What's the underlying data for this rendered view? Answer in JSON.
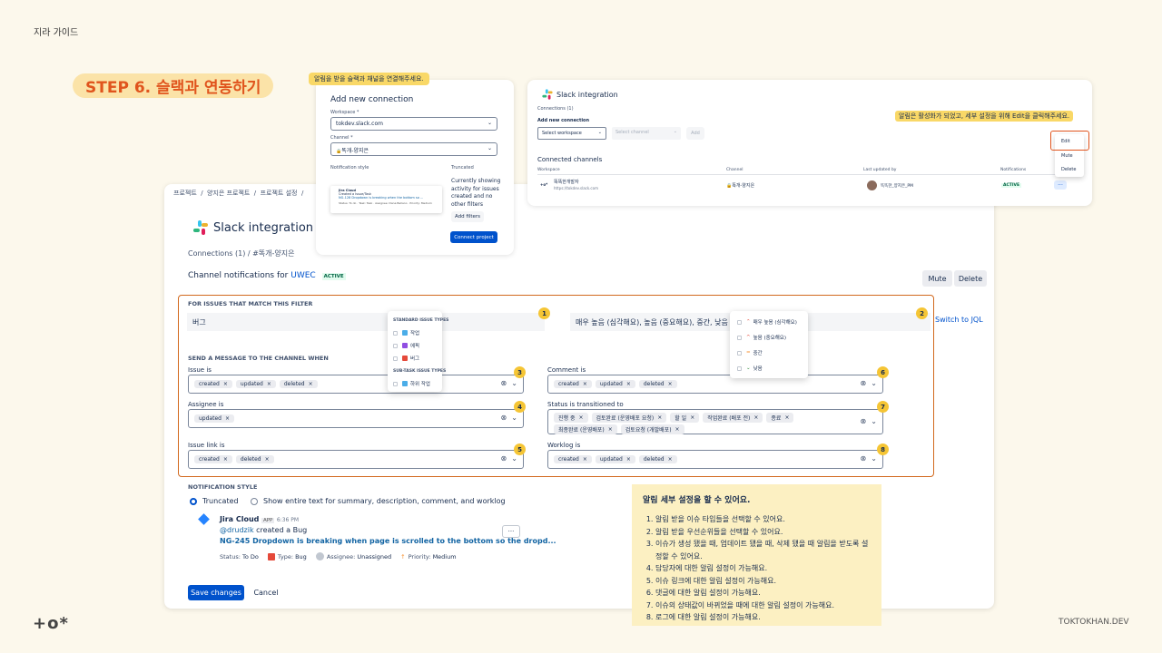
{
  "guide_title": "지라 가이드",
  "step_title": "STEP 6. 슬랙과 연동하기",
  "footer_brand": "TOKTOKHAN.DEV",
  "main": {
    "breadcrumb": [
      "프로젝트",
      "/",
      "양지은 프로젝트",
      "/",
      "프로젝트 설정",
      "/"
    ],
    "title": "Slack integration",
    "connections_crumb": "Connections (1)  /  #똑개-양지은",
    "channel_notif_prefix": "Channel notifications for",
    "channel_notif_name": "UWEC",
    "active_badge": "ACTIVE",
    "mute_label": "Mute",
    "delete_label": "Delete",
    "filter_heading": "FOR ISSUES THAT MATCH THIS FILTER",
    "filter_type_value": "버그",
    "filter_priority_value": "매우 높음 (심각해요), 높음 (중요해요), 중간, 낮음",
    "switch_jql": "Switch to JQL",
    "send_heading": "SEND A MESSAGE TO THE CHANNEL WHEN",
    "issue_is_label": "Issue is",
    "issue_is_chips": [
      "created",
      "updated",
      "deleted"
    ],
    "assignee_label": "Assignee is",
    "assignee_chips": [
      "updated"
    ],
    "issue_link_label": "Issue link is",
    "issue_link_chips": [
      "created",
      "deleted"
    ],
    "comment_label": "Comment is",
    "comment_chips": [
      "created",
      "updated",
      "deleted"
    ],
    "status_label": "Status is transitioned to",
    "status_chips": [
      "진행 중",
      "검토완료 (운영배포 요청)",
      "할 일",
      "작업완료 (배포 전)",
      "종료",
      "최종완료 (운영배포)",
      "검토요청 (개발배포)"
    ],
    "worklog_label": "Worklog is",
    "worklog_chips": [
      "created",
      "updated",
      "deleted"
    ],
    "type_dropdown": {
      "std_header": "STANDARD ISSUE TYPES",
      "items": [
        "작업",
        "에픽",
        "버그"
      ],
      "sub_header": "SUB-TASK ISSUE TYPES",
      "sub_items": [
        "하위 작업"
      ]
    },
    "priority_dropdown": [
      "매우 높음 (심각해요)",
      "높음 (중요해요)",
      "중간",
      "낮음"
    ],
    "notif_style_heading": "NOTIFICATION STYLE",
    "opt_truncated": "Truncated",
    "opt_full": "Show entire text for summary, description, comment, and worklog",
    "preview": {
      "app": "Jira Cloud",
      "app_badge": "APP",
      "time": "6:36 PM",
      "line1_user": "@drudzik",
      "line1_rest": " created a Bug",
      "link": "NG-245 Dropdown is breaking when page is scrolled to the bottom so the dropd...",
      "status_k": "Status:",
      "status_v": "To Do",
      "type_k": "Type:",
      "type_v": "Bug",
      "assignee_k": "Assignee:",
      "assignee_v": "Unassigned",
      "priority_k": "Priority:",
      "priority_v": "Medium",
      "more": "···"
    },
    "save_label": "Save changes",
    "cancel_label": "Cancel"
  },
  "add_conn": {
    "tag": "알림을 받을 슬랙과 채널을 연결해주세요.",
    "title": "Add new connection",
    "ws_label": "Workspace *",
    "ws_value": "tokdev.slack.com",
    "ch_label": "Channel *",
    "ch_value": "똑개-양지은",
    "style_label": "Notification style",
    "trunc_label": "Truncated",
    "trunc_text": "Currently showing activity for issues created and no other filters",
    "add_filters": "Add filters",
    "connect": "Connect project",
    "mini_app": "Jira Cloud",
    "mini_text1": "Created a Issue/Task",
    "mini_text2": "NG-128 Dropdown is breaking when the bottom so ...",
    "mini_row": [
      "Status: To do",
      "Task: Task",
      "Assignee: Dana Bellano",
      "Priority: Medium"
    ]
  },
  "right_card": {
    "title": "Slack integration",
    "connections": "Connections (1)",
    "add_new": "Add new connection",
    "select_ws": "Select workspace",
    "select_ch": "Select channel",
    "add_btn": "Add",
    "tag": "알림은 활성화가 되었고, 세부 설정을 위해 Edit을 클릭해주세요.",
    "connected": "Connected channels",
    "cols": [
      "Workspace",
      "Channel",
      "Last updated by",
      "Notifications"
    ],
    "ws_name": "똑똑한개발자",
    "ws_url": "https://tokdev.slack.com",
    "channel": "똑개-양지은",
    "updated_by": "똑똑한_양지은_PM",
    "status": "ACTIVE",
    "menu": [
      "Edit",
      "Mute",
      "Delete"
    ],
    "more": "···"
  },
  "summary": {
    "title": "알림 세부 설정을 할 수 있어요.",
    "items": [
      "알림 받을 이슈 타입들을 선택할 수 있어요.",
      "알림 받을 우선순위들을 선택할 수 있어요.",
      "이슈가 생성 됐을 때, 업데이트 됐을 때, 삭제 됐을 때 알림을 받도록 설정할 수 있어요.",
      "담당자에 대한 알림 설정이 가능해요.",
      "이슈 링크에 대한 알림 설정이 가능해요.",
      "댓글에 대한 알림 설정이 가능해요.",
      "이슈의 상태값이 바뀌었을 때에 대한 알림 설정이 가능해요.",
      "로그에 대한 알림 설정이 가능해요."
    ]
  },
  "numbers": [
    "1",
    "2",
    "3",
    "4",
    "5",
    "6",
    "7",
    "8"
  ]
}
